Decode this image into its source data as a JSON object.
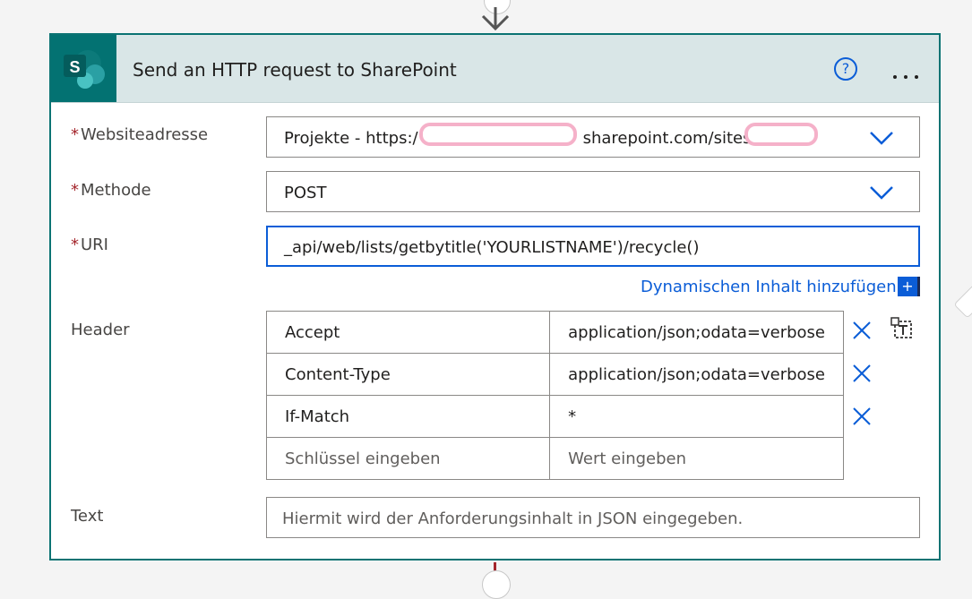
{
  "header": {
    "title": "Send an HTTP request to SharePoint",
    "app_letter": "S",
    "help_glyph": "?"
  },
  "fields": {
    "site": {
      "label": "Websiteadresse",
      "value_prefix": "Projekte - https:/",
      "value_middle": "sharepoint.com/sites"
    },
    "method": {
      "label": "Methode",
      "value": "POST"
    },
    "uri": {
      "label": "URI",
      "value": "_api/web/lists/getbytitle('YOURLISTNAME')/recycle()"
    },
    "dynamic_link": "Dynamischen Inhalt hinzufügen",
    "dynamic_plus": "+",
    "headers": {
      "label": "Header",
      "rows": [
        {
          "key": "Accept",
          "value": "application/json;odata=verbose"
        },
        {
          "key": "Content-Type",
          "value": "application/json;odata=verbose"
        },
        {
          "key": "If-Match",
          "value": "*"
        }
      ],
      "key_placeholder": "Schlüssel eingeben",
      "value_placeholder": "Wert eingeben"
    },
    "body": {
      "label": "Text",
      "placeholder": "Hiermit wird der Anforderungsinhalt in JSON eingegeben."
    }
  },
  "required_marker": "*",
  "colors": {
    "accent": "#0b5dd7",
    "brand_teal": "#037272",
    "header_bg": "#d9e6e7",
    "required": "#a4262c",
    "redaction": "#f5b1c9"
  },
  "icons": [
    "sharepoint-icon",
    "help-icon",
    "more-options-icon",
    "chevron-down-icon",
    "close-icon",
    "text-template-icon"
  ]
}
